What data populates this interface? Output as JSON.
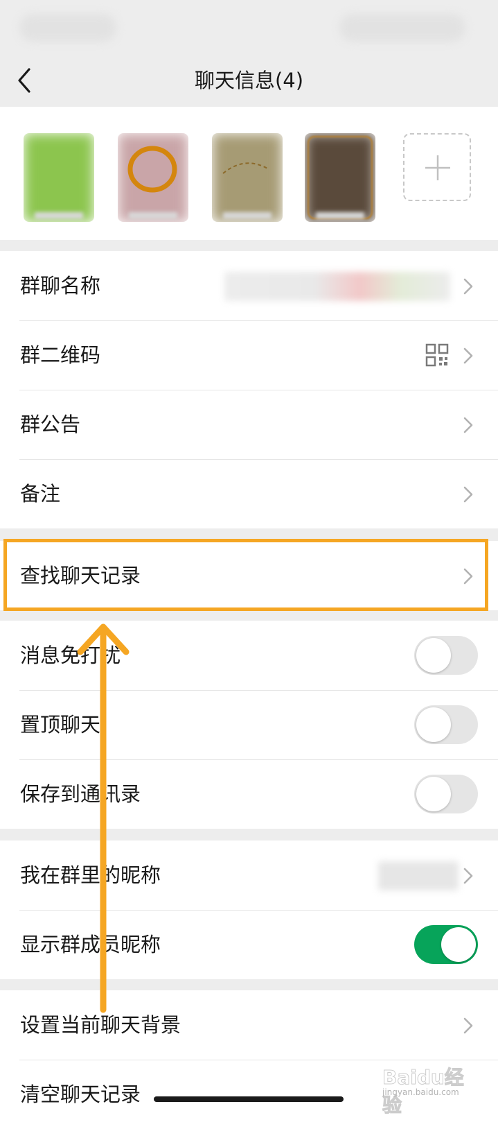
{
  "header": {
    "title": "聊天信息(4)",
    "back_icon": "chevron-left-icon"
  },
  "members": {
    "avatars": [
      {
        "color": "#8cc54e"
      },
      {
        "color": "#c9a5a8"
      },
      {
        "color": "#a69b74"
      },
      {
        "color": "#5a4a3b"
      }
    ],
    "add_icon": "plus-icon"
  },
  "group_info": {
    "items": [
      {
        "label": "群聊名称"
      },
      {
        "label": "群二维码",
        "icon": "qr-code-icon"
      },
      {
        "label": "群公告"
      },
      {
        "label": "备注"
      }
    ]
  },
  "search": {
    "label": "查找聊天记录"
  },
  "chat_settings": {
    "items": [
      {
        "label": "消息免打扰",
        "on": false
      },
      {
        "label": "置顶聊天",
        "on": false
      },
      {
        "label": "保存到通讯录",
        "on": false
      }
    ]
  },
  "nickname": {
    "items": [
      {
        "label": "我在群里的昵称"
      },
      {
        "label": "显示群成员昵称",
        "on": true
      }
    ]
  },
  "background": {
    "items": [
      {
        "label": "设置当前聊天背景"
      },
      {
        "label": "清空聊天记录"
      }
    ]
  },
  "annotation": {
    "highlight_color": "#f5a623"
  },
  "watermark": {
    "main": "Baidu经验",
    "sub": "jingyan.baidu.com"
  },
  "colors": {
    "toggle_on": "#07a45a",
    "toggle_off": "#e5e5e5",
    "page_bg": "#ededed"
  }
}
